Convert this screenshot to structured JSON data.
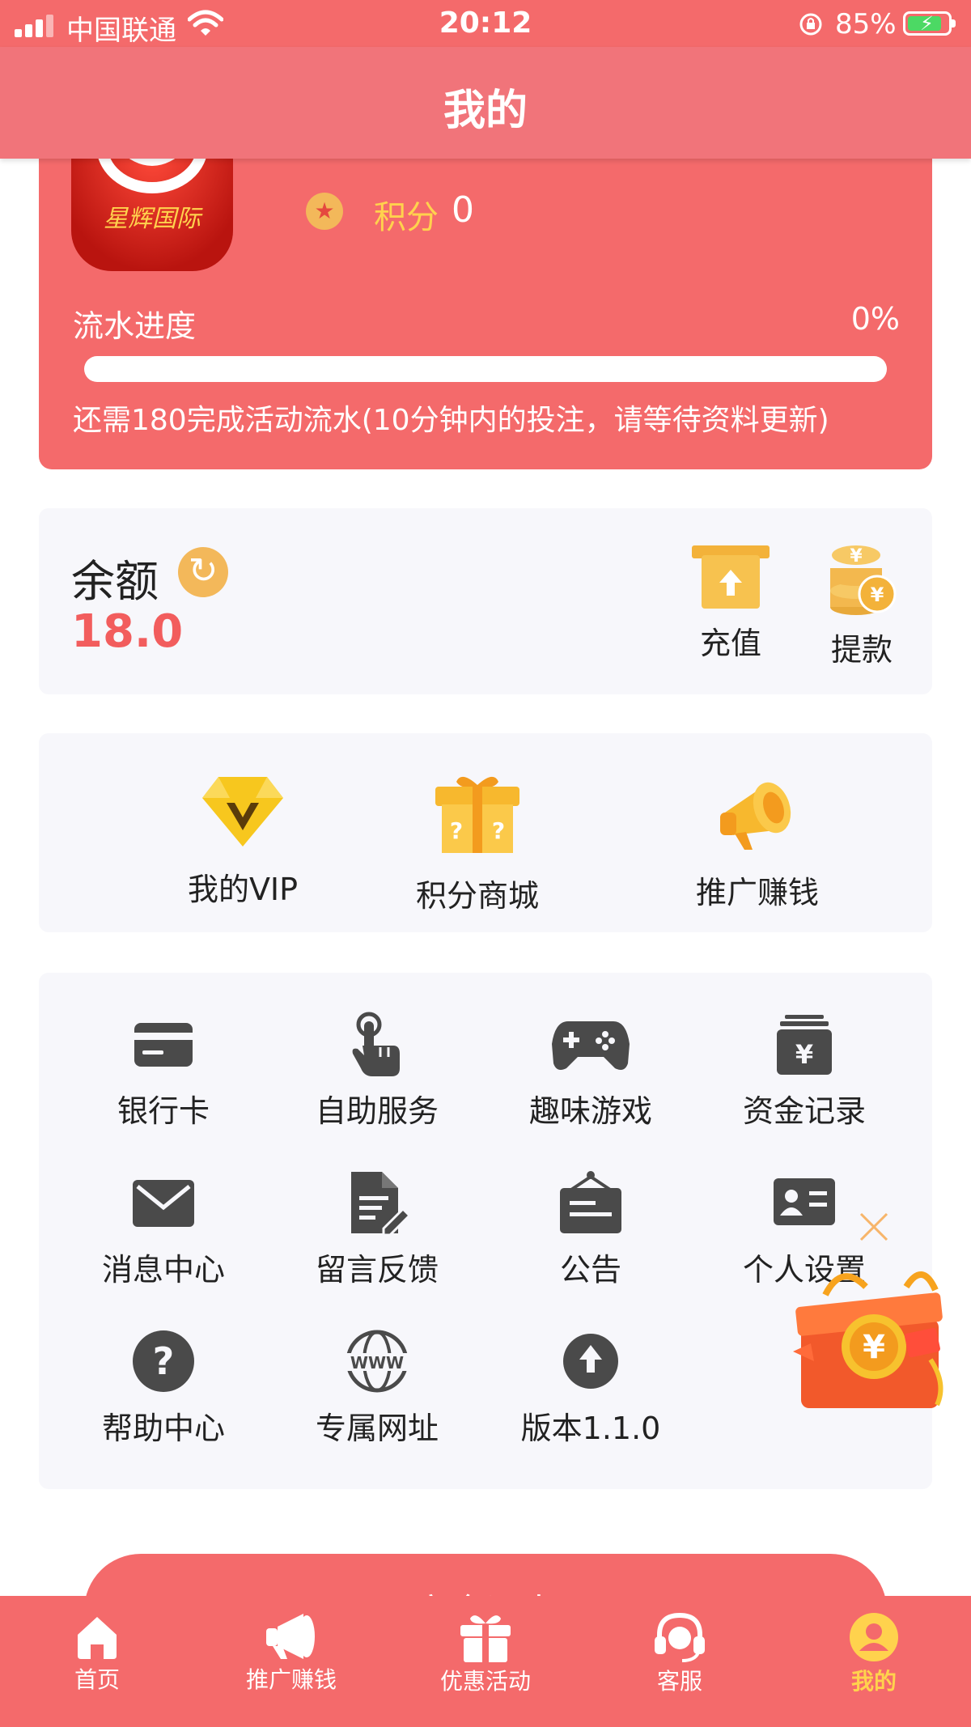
{
  "status_bar": {
    "carrier": "中国联通",
    "time": "20:12",
    "battery_percent": "85%",
    "battery_level": 0.85
  },
  "nav": {
    "title": "我的"
  },
  "profile": {
    "avatar_logo_text": "星辉国际",
    "points_label": "积分",
    "points_value": "0",
    "progress_label": "流水进度",
    "progress_percent": "0%",
    "progress_fraction": 0,
    "progress_note": "还需180完成活动流水(10分钟内的投注，请等待资料更新)"
  },
  "balance": {
    "label": "余额",
    "amount": "18.0",
    "actions": [
      {
        "label": "充值",
        "icon": "atm-deposit-icon"
      },
      {
        "label": "提款",
        "icon": "coin-stack-icon"
      }
    ]
  },
  "features": [
    {
      "label": "我的VIP",
      "icon": "diamond-vip-icon"
    },
    {
      "label": "积分商城",
      "icon": "mystery-box-icon"
    },
    {
      "label": "推广赚钱",
      "icon": "megaphone-icon"
    }
  ],
  "grid": [
    {
      "label": "银行卡",
      "icon": "bank-card-icon"
    },
    {
      "label": "自助服务",
      "icon": "tap-hand-icon"
    },
    {
      "label": "趣味游戏",
      "icon": "gamepad-icon"
    },
    {
      "label": "资金记录",
      "icon": "money-record-icon"
    },
    {
      "label": "消息中心",
      "icon": "mail-icon"
    },
    {
      "label": "留言反馈",
      "icon": "feedback-icon"
    },
    {
      "label": "公告",
      "icon": "notice-board-icon"
    },
    {
      "label": "个人设置",
      "icon": "id-card-icon"
    },
    {
      "label": "帮助中心",
      "icon": "help-icon"
    },
    {
      "label": "专属网址",
      "icon": "www-globe-icon"
    },
    {
      "label": "版本1.1.0",
      "icon": "upload-icon"
    }
  ],
  "logout": {
    "label": "安全退出"
  },
  "tabs": [
    {
      "label": "首页",
      "icon": "home-icon"
    },
    {
      "label": "推广赚钱",
      "icon": "megaphone-icon"
    },
    {
      "label": "优惠活动",
      "icon": "gift-icon"
    },
    {
      "label": "客服",
      "icon": "headset-icon"
    },
    {
      "label": "我的",
      "icon": "user-icon",
      "active": true
    }
  ],
  "colors": {
    "primary": "#f46a6b",
    "accent": "#ffd24d",
    "card_bg": "#f7f7fb",
    "icon_dark": "#444444",
    "amount_red": "#f25d5d"
  }
}
